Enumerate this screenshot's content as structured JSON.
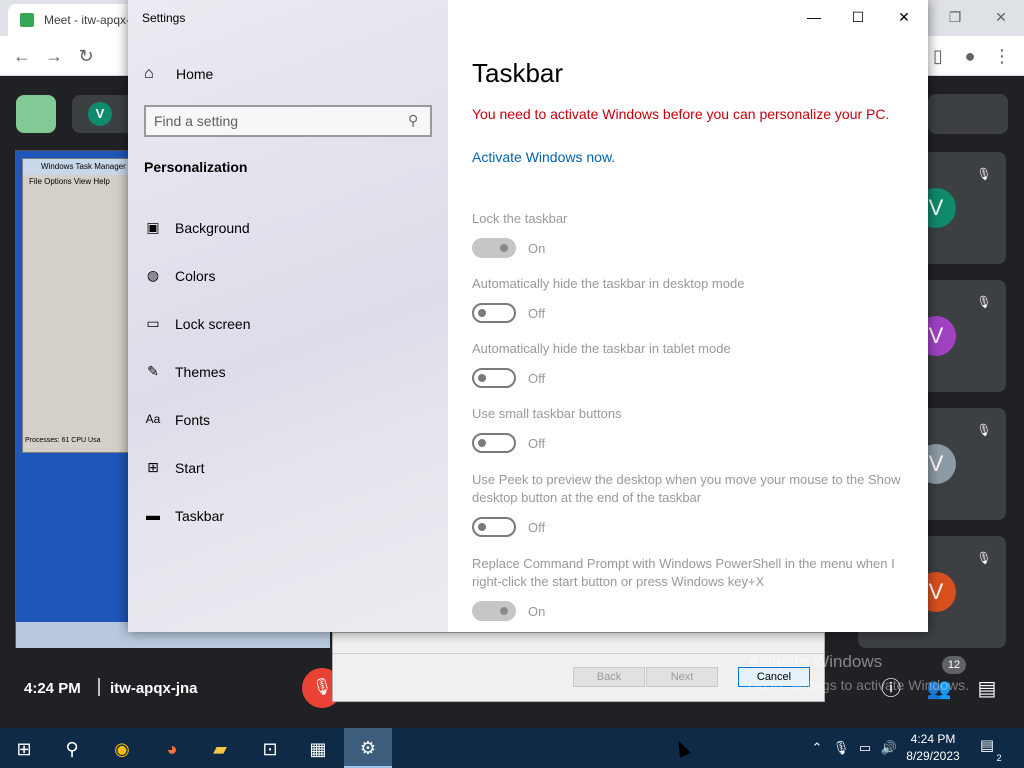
{
  "browser": {
    "tab_title": "Meet - itw-apqx-jna"
  },
  "meet": {
    "avatar_initial": "V",
    "time": "4:24 PM",
    "meeting_code": "itw-apqx-jna",
    "participant_count": "12",
    "participants": [
      {
        "initial": "V",
        "color": "#0f8a6b"
      },
      {
        "initial": "V",
        "color": "#a142c4"
      },
      {
        "initial": "V",
        "color": "#8e9aa4"
      },
      {
        "initial": "V",
        "color": "#d9501e"
      }
    ],
    "watermark_line1": "Activate Windows",
    "watermark_line2": "Go to Settings to activate Windows."
  },
  "shared_screen": {
    "taskmgr_title": "Windows Task Manager",
    "taskmgr_menu": "File   Options   View   Help",
    "taskmgr_status": "Processes: 61     CPU Usa"
  },
  "wizard": {
    "back_label": "Back",
    "next_label": "Next",
    "cancel_label": "Cancel"
  },
  "settings": {
    "window_title": "Settings",
    "home_label": "Home",
    "search_placeholder": "Find a setting",
    "section_title": "Personalization",
    "nav": [
      {
        "label": "Background",
        "icon": "image-icon"
      },
      {
        "label": "Colors",
        "icon": "palette-icon"
      },
      {
        "label": "Lock screen",
        "icon": "lock-screen-icon"
      },
      {
        "label": "Themes",
        "icon": "themes-icon"
      },
      {
        "label": "Fonts",
        "icon": "fonts-icon"
      },
      {
        "label": "Start",
        "icon": "start-icon"
      },
      {
        "label": "Taskbar",
        "icon": "taskbar-icon"
      }
    ],
    "page_title": "Taskbar",
    "activation_warning": "You need to activate Windows before you can personalize your PC.",
    "activate_link": "Activate Windows now.",
    "options": [
      {
        "label": "Lock the taskbar",
        "state": "On"
      },
      {
        "label": "Automatically hide the taskbar in desktop mode",
        "state": "Off"
      },
      {
        "label": "Automatically hide the taskbar in tablet mode",
        "state": "Off"
      },
      {
        "label": "Use small taskbar buttons",
        "state": "Off"
      },
      {
        "label": "Use Peek to preview the desktop when you move your mouse to the Show desktop button at the end of the taskbar",
        "state": "Off"
      },
      {
        "label": "Replace Command Prompt with Windows PowerShell in the menu when I right-click the start button or press Windows key+X",
        "state": "On"
      }
    ]
  },
  "taskbar": {
    "clock_time": "4:24 PM",
    "clock_date": "8/29/2023",
    "notification_count": "2"
  }
}
